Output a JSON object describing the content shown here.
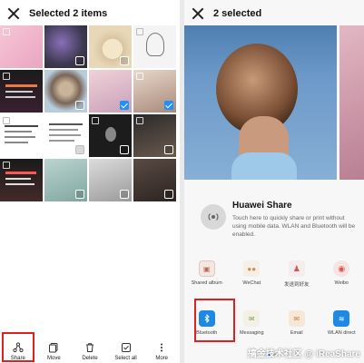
{
  "left": {
    "title": "Selected 2 items",
    "bottom_actions": [
      {
        "label": "Share",
        "icon": "share-icon"
      },
      {
        "label": "Move",
        "icon": "move-icon"
      },
      {
        "label": "Delete",
        "icon": "delete-icon"
      },
      {
        "label": "Select all",
        "icon": "select-all-icon"
      },
      {
        "label": "More",
        "icon": "more-icon"
      }
    ]
  },
  "right": {
    "title": "2 selected",
    "huawei_share": {
      "title": "Huawei Share",
      "description": "Touch here to quickly share or print without using mobile data. WLAN and Bluetooth will be enabled."
    },
    "apps_row1": [
      {
        "label": "Shared album",
        "icon": "shared-album-icon",
        "color": "#e8e3df"
      },
      {
        "label": "WeChat",
        "icon": "wechat-icon",
        "color": "#eee9e2"
      },
      {
        "label": "发送到好友",
        "icon": "send-friend-icon",
        "color": "#f0e6e6"
      },
      {
        "label": "Weibo",
        "icon": "weibo-icon",
        "color": "#f3e4e4"
      }
    ],
    "apps_row2": [
      {
        "label": "Bluetooth",
        "icon": "bluetooth-icon",
        "color": "#1e88e5"
      },
      {
        "label": "Messaging",
        "icon": "messaging-icon",
        "color": "#f1f1e6"
      },
      {
        "label": "Email",
        "icon": "email-icon",
        "color": "#f3e7d9"
      },
      {
        "label": "WLAN direct",
        "icon": "wlan-direct-icon",
        "color": "#1e88e5"
      }
    ],
    "watermark": "搞金技术社区 @ iReaShare"
  }
}
